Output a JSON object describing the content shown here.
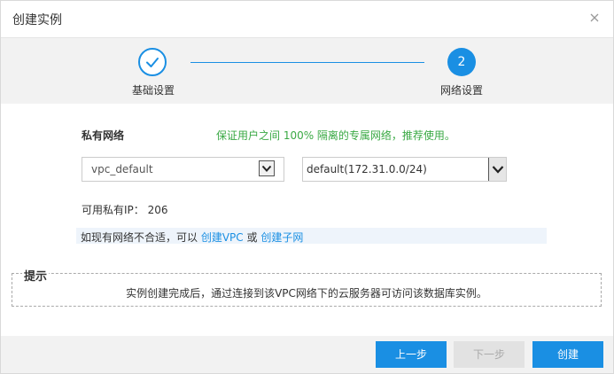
{
  "dialog": {
    "title": "创建实例"
  },
  "steps": [
    {
      "label": "基础设置",
      "state": "done"
    },
    {
      "number": "2",
      "label": "网络设置",
      "state": "active"
    }
  ],
  "network": {
    "section_title": "私有网络",
    "tip": "保证用户之间 100% 隔离的专属网络，推荐使用。",
    "vpc_select_value": "vpc_default",
    "subnet_select_value": "default(172.31.0.0/24)",
    "available_ip_label": "可用私有IP：",
    "available_ip_count": "206",
    "hint_prefix": "如现有网络不合适，可以",
    "create_vpc_link": "创建VPC",
    "hint_or": "或",
    "create_subnet_link": "创建子网"
  },
  "notice": {
    "title": "提示",
    "text": "实例创建完成后，通过连接到该VPC网络下的云服务器可访问该数据库实例。"
  },
  "footer": {
    "prev_label": "上一步",
    "next_label": "下一步",
    "create_label": "创建"
  },
  "colors": {
    "accent": "#1a8fe3",
    "tip_green": "#3aa944"
  }
}
